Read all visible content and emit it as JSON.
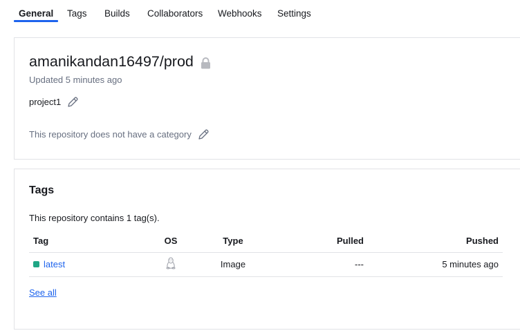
{
  "tabs": [
    {
      "label": "General",
      "active": true
    },
    {
      "label": "Tags"
    },
    {
      "label": "Builds"
    },
    {
      "label": "Collaborators"
    },
    {
      "label": "Webhooks"
    },
    {
      "label": "Settings"
    }
  ],
  "repo": {
    "name": "amanikandan16497/prod",
    "updated": "Updated 5 minutes ago",
    "description": "project1",
    "category": "This repository does not have a category"
  },
  "tags_section": {
    "title": "Tags",
    "summary": "This repository contains 1 tag(s).",
    "columns": {
      "tag": "Tag",
      "os": "OS",
      "type": "Type",
      "pulled": "Pulled",
      "pushed": "Pushed"
    },
    "rows": [
      {
        "tag": "latest",
        "os_icon": "linux-icon",
        "type": "Image",
        "pulled": "---",
        "pushed": "5 minutes ago"
      }
    ],
    "see_all": "See all"
  },
  "colors": {
    "accent": "#1d63ed",
    "tag_status": "#1fa685",
    "muted_text": "#676f80"
  },
  "icons": {
    "private": "lock-icon",
    "edit": "pencil-icon"
  }
}
